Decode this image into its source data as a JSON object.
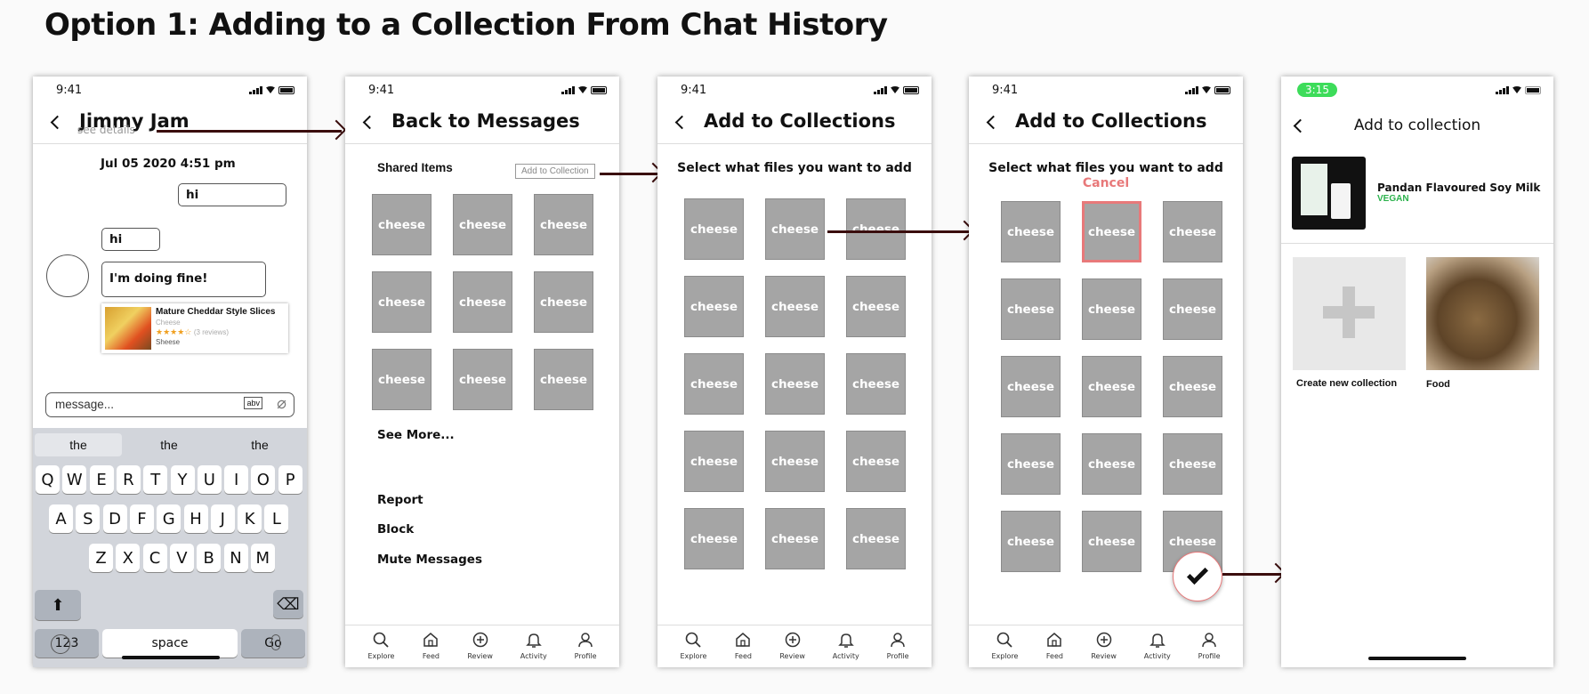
{
  "page_title": "Option 1: Adding to a Collection From Chat History",
  "status_time": "9:41",
  "tile_label": "cheese",
  "tabs": [
    "Explore",
    "Feed",
    "Review",
    "Activity",
    "Profile"
  ],
  "screen1": {
    "title": "Jimmy Jam",
    "see_details": "see details",
    "date": "Jul 05 2020 4:51 pm",
    "sent_msg": "hi",
    "recv_msg1": "hi",
    "recv_msg2": "I'm doing fine!",
    "product": {
      "name": "Mature Cheddar Style Slices",
      "category": "Cheese",
      "stars": "★★★★☆",
      "reviews": "(3 reviews)",
      "brand": "Sheese"
    },
    "input_placeholder": "message...",
    "abv": "abv",
    "suggestions": [
      "the",
      "the",
      "the"
    ],
    "row1": [
      "Q",
      "W",
      "E",
      "R",
      "T",
      "Y",
      "U",
      "I",
      "O",
      "P"
    ],
    "row2": [
      "A",
      "S",
      "D",
      "F",
      "G",
      "H",
      "J",
      "K",
      "L"
    ],
    "row3": [
      "Z",
      "X",
      "C",
      "V",
      "B",
      "N",
      "M"
    ],
    "key_123": "123",
    "key_space": "space",
    "key_go": "Go"
  },
  "screen2": {
    "title": "Back to Messages",
    "shared_items": "Shared Items",
    "add_to_collection": "Add to Collection",
    "see_more": "See More...",
    "report": "Report",
    "block": "Block",
    "mute": "Mute Messages"
  },
  "screen3": {
    "title": "Add to Collections",
    "prompt": "Select what files you want to add"
  },
  "screen4": {
    "title": "Add to Collections",
    "prompt": "Select what files you want to add",
    "cancel": "Cancel"
  },
  "screen5": {
    "status_time": "3:15",
    "title": "Add to collection",
    "product_name": "Pandan Flavoured Soy Milk",
    "product_tag": "VEGAN",
    "create_new": "Create new collection",
    "food": "Food"
  },
  "colors": {
    "arrow": "#3a0d0d",
    "tile": "#a5a5a5",
    "selected": "#e8797a",
    "cancel": "#e8797a",
    "vegan": "#2bb24c",
    "status_pill": "#3ddc5a"
  }
}
